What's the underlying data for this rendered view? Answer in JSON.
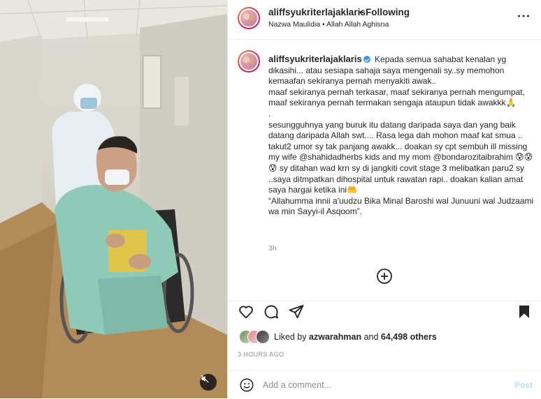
{
  "header": {
    "username": "aliffsyukriterlajaklaris",
    "separator": "•",
    "follow_status": "Following",
    "audio": "Nazwa Maulidia • Allah Allah Aghisna",
    "more_icon": "more-horizontal-icon"
  },
  "caption": {
    "username": "aliffsyukriterlajaklaris",
    "text": "Kepada semua sahabat kenalan yg dikasihi... atau sesiapa sahaja saya mengenali sy..sy memohon kemaafan sekiranya pernah menyakiti awak..\nmaaf sekiranya pernah terkasar, maaf sekiranya pernah mengumpat, maaf sekiranya pernah termakan sengaja ataupun tidak awakkk🙏\n.\nsesungguhnya yang buruk itu datang daripada saya dan yang baik datang daripada Allah swt.... Rasa lega dah mohon maaf kat smua .. takut2 umor sy tak panjang awakk... doakan sy cpt sembuh ill missing my wife @shahidadherbs kids and my mom @bondarozitaibrahim 😰😰😰 sy ditahan wad krn sy di jangkiti covit stage 3 melibatkan paru2 sy ..saya ditmpatkan dihospital untuk rawatan rapi.. doakan kalian amat saya hargai ketika ini🤲\n“Allahumma innii a'uudzu Bika Minal Baroshi wal Junuuni wal Judzaami wa min Sayyi-il Asqoom”.",
    "time": "3h"
  },
  "actions": {
    "like_icon": "heart-icon",
    "comment_icon": "comment-icon",
    "share_icon": "send-icon",
    "save_icon": "bookmark-icon"
  },
  "likes": {
    "prefix": "Liked by",
    "user": "azwarahman",
    "middle": "and",
    "count": "64,498 others"
  },
  "posted_ago": "3 HOURS AGO",
  "comment": {
    "placeholder": "Add a comment...",
    "post_label": "Post"
  },
  "colors": {
    "accent": "#3897f0",
    "post_disabled": "#b2dffc",
    "text": "#262626",
    "muted": "#8e8e8e"
  }
}
